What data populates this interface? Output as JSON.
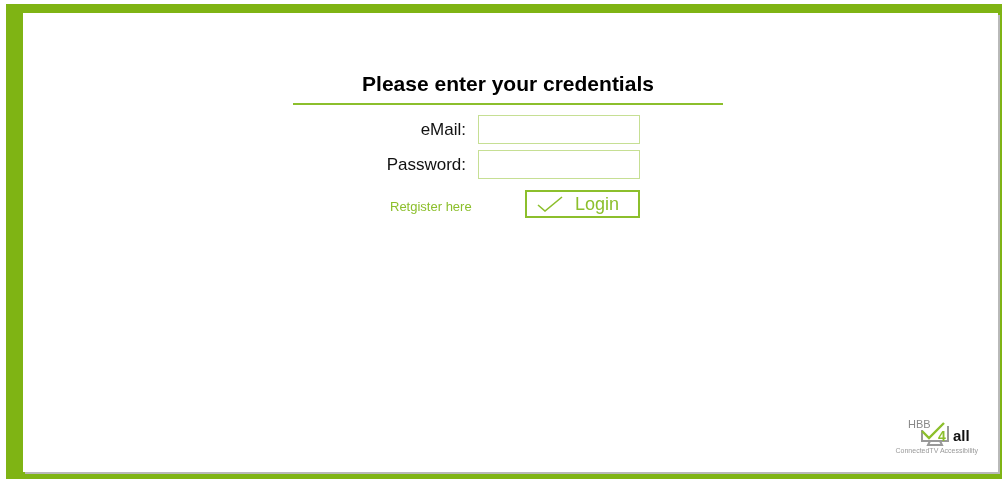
{
  "login_form": {
    "title": "Please enter your credentials",
    "fields": [
      {
        "label": "eMail:"
      },
      {
        "label": "Password:"
      }
    ],
    "register_link": "Retgister here",
    "login_button": "Login"
  },
  "logo": {
    "top": "HBB",
    "digit": "4",
    "word": "all",
    "tagline": "ConnectedTV Accessibility"
  }
}
